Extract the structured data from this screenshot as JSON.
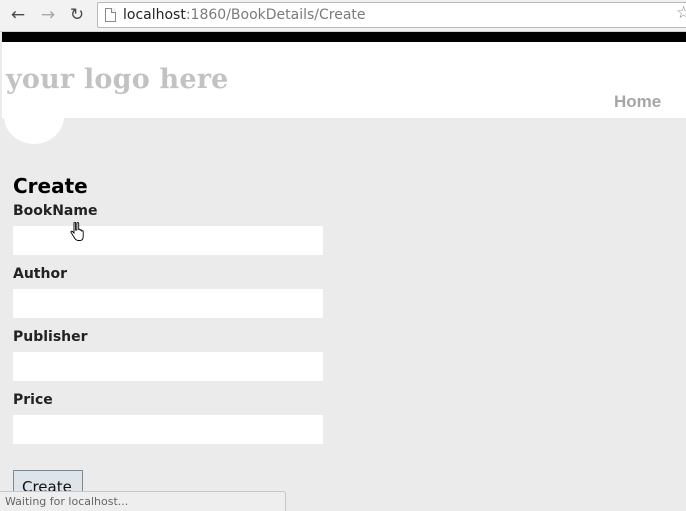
{
  "browser": {
    "url_host": "localhost",
    "url_path": ":1860/BookDetails/Create",
    "back_label": "←",
    "forward_label": "→",
    "reload_label": "↻",
    "star_label": "☆",
    "status_text": "Waiting for localhost..."
  },
  "header": {
    "logo_text": "your logo here",
    "nav_home": "Home"
  },
  "form": {
    "title": "Create",
    "fields": [
      {
        "label": "BookName",
        "value": ""
      },
      {
        "label": "Author",
        "value": ""
      },
      {
        "label": "Publisher",
        "value": ""
      },
      {
        "label": "Price",
        "value": ""
      }
    ],
    "submit_label": "Create"
  },
  "colors": {
    "page_background": "#ebebeb",
    "header_background": "#ffffff",
    "top_bar": "#000000",
    "logo_text": "#c2c2c2",
    "nav_text": "#a6a6a6"
  }
}
